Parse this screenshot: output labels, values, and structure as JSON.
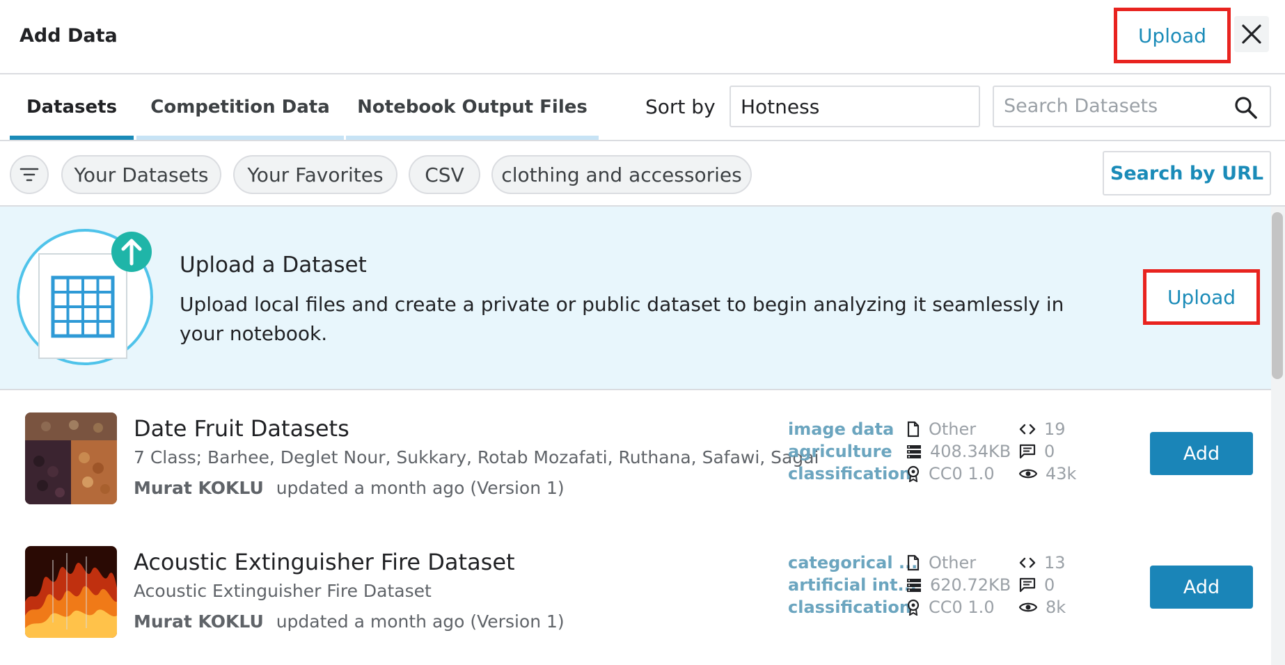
{
  "header": {
    "title": "Add Data",
    "upload_label": "Upload"
  },
  "tabs": [
    {
      "label": "Datasets",
      "active": true
    },
    {
      "label": "Competition Data",
      "active": false
    },
    {
      "label": "Notebook Output Files",
      "active": false
    }
  ],
  "sort": {
    "label": "Sort by",
    "value": "Hotness"
  },
  "search": {
    "placeholder": "Search Datasets"
  },
  "filters": {
    "chips": [
      "Your Datasets",
      "Your Favorites",
      "CSV",
      "clothing and accessories"
    ],
    "search_by_url_label": "Search by URL"
  },
  "banner": {
    "title": "Upload a Dataset",
    "description": "Upload local files and create a private or public dataset to begin analyzing it seamlessly in your notebook.",
    "upload_label": "Upload"
  },
  "datasets": [
    {
      "title": "Date Fruit Datasets",
      "subtitle": "7 Class; Barhee, Deglet Nour, Sukkary, Rotab Mozafati, Ruthana, Safawi, Sagai",
      "owner": "Murat KOKLU",
      "updated": "updated a month ago (Version 1)",
      "tags": [
        "image data",
        "agriculture",
        "classification"
      ],
      "file_type": "Other",
      "size": "408.34KB",
      "license": "CC0 1.0",
      "code_count": "19",
      "comment_count": "0",
      "views": "43k",
      "add_label": "Add"
    },
    {
      "title": "Acoustic Extinguisher Fire Dataset",
      "subtitle": "Acoustic Extinguisher Fire Dataset",
      "owner": "Murat KOKLU",
      "updated": "updated a month ago (Version 1)",
      "tags": [
        "categorical ...",
        "artificial int...",
        "classification"
      ],
      "file_type": "Other",
      "size": "620.72KB",
      "license": "CC0 1.0",
      "code_count": "13",
      "comment_count": "0",
      "views": "8k",
      "add_label": "Add"
    }
  ],
  "colors": {
    "accent": "#1a8bb8",
    "highlight_box": "#e8231f",
    "banner_bg": "#e8f6fc",
    "tag_text": "#6ba5bf"
  }
}
